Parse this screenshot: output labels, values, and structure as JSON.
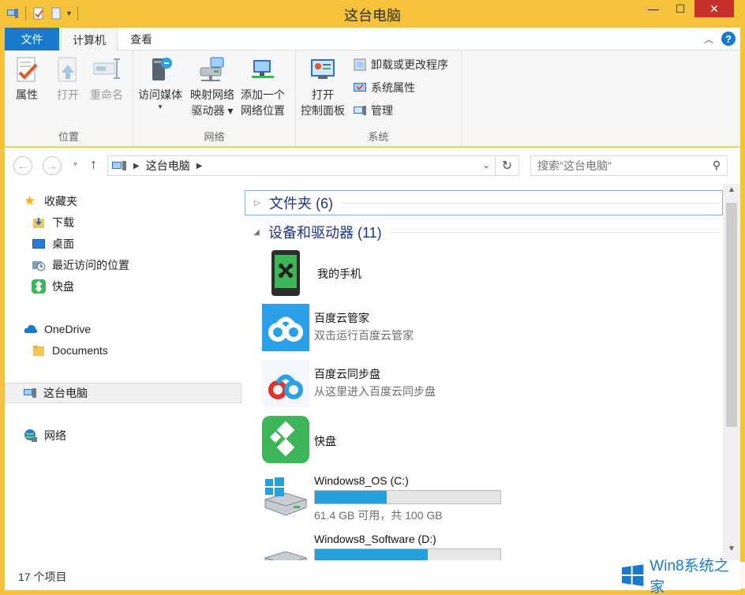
{
  "window": {
    "title": "这台电脑",
    "controls": {
      "minimize": "—",
      "maximize": "☐",
      "close": "✕"
    }
  },
  "ribbon_tabs": {
    "file": "文件",
    "computer": "计算机",
    "view": "查看"
  },
  "ribbon": {
    "location_group": {
      "label": "位置",
      "properties": "属性",
      "open": "打开",
      "rename": "重命名"
    },
    "network_group": {
      "label": "网络",
      "access_media_line1": "访问媒体",
      "map_drive_line1": "映射网络",
      "map_drive_line2": "驱动器",
      "add_location_line1": "添加一个",
      "add_location_line2": "网络位置"
    },
    "system_group": {
      "label": "系统",
      "open_cp_line1": "打开",
      "open_cp_line2": "控制面板",
      "uninstall": "卸载或更改程序",
      "system_properties": "系统属性",
      "manage": "管理"
    }
  },
  "address": {
    "path": "这台电脑",
    "search_placeholder": "搜索\"这台电脑\""
  },
  "nav_pane": {
    "favorites": "收藏夹",
    "downloads": "下载",
    "desktop": "桌面",
    "recent": "最近访问的位置",
    "kuaipan": "快盘",
    "onedrive": "OneDrive",
    "documents": "Documents",
    "this_pc": "这台电脑",
    "network": "网络"
  },
  "content": {
    "folders_header": "文件夹 (6)",
    "devices_header": "设备和驱动器 (11)",
    "devices": {
      "phone": {
        "name": "我的手机"
      },
      "baidu_guard": {
        "name": "百度云管家",
        "desc": "双击运行百度云管家"
      },
      "baidu_sync": {
        "name": "百度云同步盘",
        "desc": "从这里进入百度云同步盘"
      },
      "kuaipan": {
        "name": "快盘"
      },
      "drive_c": {
        "name": "Windows8_OS (C:)",
        "free": "61.4 GB 可用，共 100 GB",
        "used_fraction": 0.386
      },
      "drive_d": {
        "name": "Windows8_Software (D:)",
        "used_fraction": 0.61
      }
    }
  },
  "status": {
    "count": "17 个项目"
  },
  "watermark": {
    "text": "Win8系统之家"
  },
  "colors": {
    "frame": "#f4c33a",
    "accent": "#1979ca",
    "drive_fill": "#26a0da",
    "kuaipan_green": "#3cb659",
    "baidu_blue": "#2b9fe8"
  }
}
